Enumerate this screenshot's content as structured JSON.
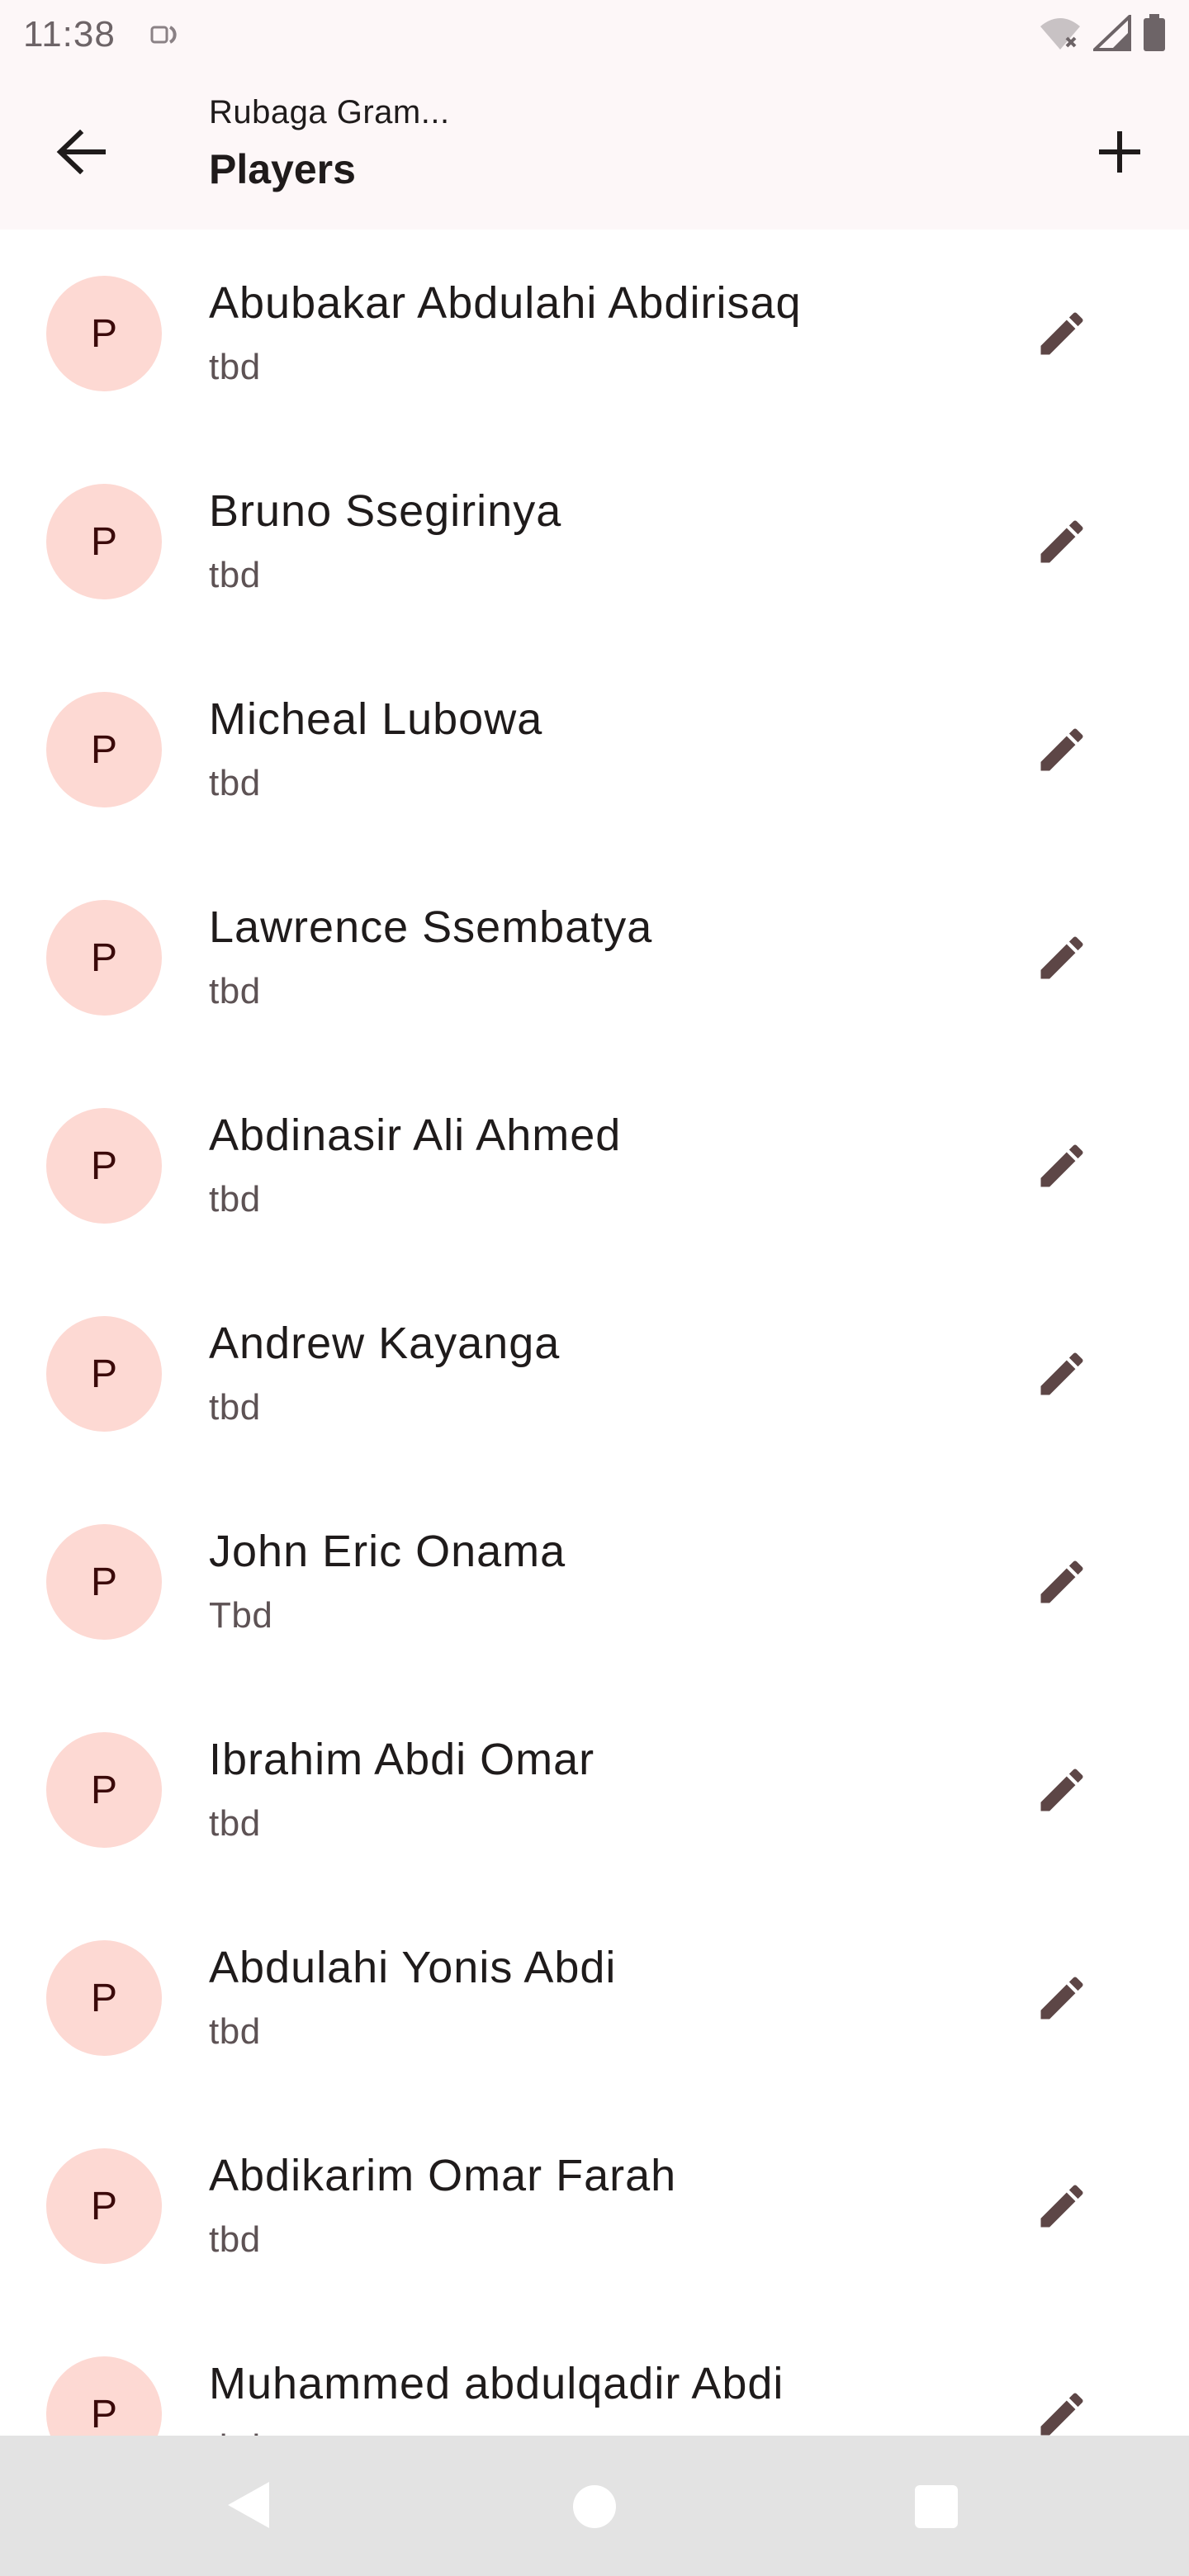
{
  "status_bar": {
    "time": "11:38",
    "icons": [
      "notification-icon",
      "wifi-off-icon",
      "signal-icon",
      "battery-icon"
    ]
  },
  "app_bar": {
    "subtitle": "Rubaga Gram...",
    "title": "Players",
    "icons": {
      "back": "arrow-back-icon",
      "add": "add-icon"
    }
  },
  "players": [
    {
      "initial": "P",
      "name": "Abubakar Abdulahi Abdirisaq",
      "note": "tbd"
    },
    {
      "initial": "P",
      "name": "Bruno Ssegirinya",
      "note": "tbd"
    },
    {
      "initial": "P",
      "name": "Micheal Lubowa",
      "note": "tbd"
    },
    {
      "initial": "P",
      "name": "Lawrence Ssembatya",
      "note": "tbd"
    },
    {
      "initial": "P",
      "name": "Abdinasir Ali Ahmed",
      "note": "tbd"
    },
    {
      "initial": "P",
      "name": "Andrew Kayanga",
      "note": "tbd"
    },
    {
      "initial": "P",
      "name": "John Eric Onama",
      "note": "Tbd"
    },
    {
      "initial": "P",
      "name": "Ibrahim Abdi Omar",
      "note": "tbd"
    },
    {
      "initial": "P",
      "name": "Abdulahi Yonis Abdi",
      "note": "tbd"
    },
    {
      "initial": "P",
      "name": "Abdikarim Omar Farah",
      "note": "tbd"
    },
    {
      "initial": "P",
      "name": "Muhammed abdulqadir Abdi",
      "note": "tbd"
    }
  ],
  "colors": {
    "app_bar_bg": "#fdf7f8",
    "avatar_bg": "#fdd9d3",
    "avatar_text": "#3b0a0a",
    "edit_icon": "#5d4646",
    "nav_bar_bg": "#e3e3e3"
  }
}
